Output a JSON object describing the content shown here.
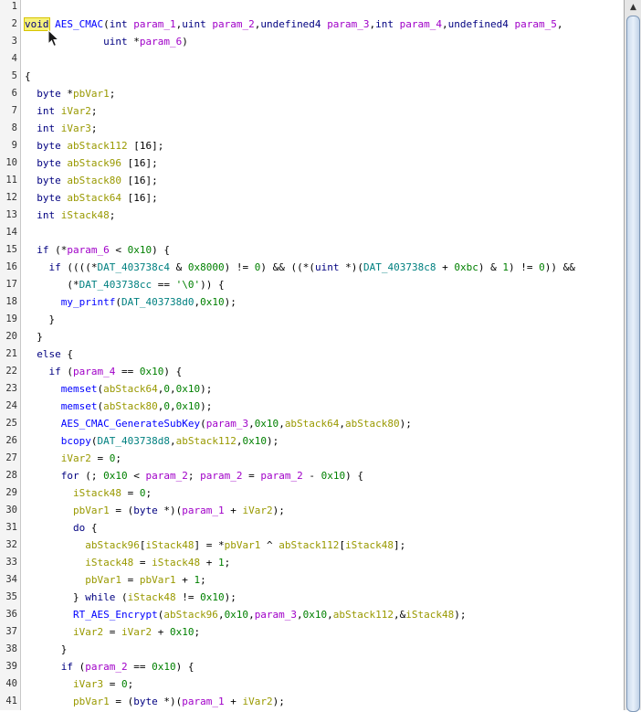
{
  "icons": {
    "cursor": "mouse-pointer-icon",
    "scroll_up": "chevron-up-icon"
  },
  "colors": {
    "keyword": "#000080",
    "function": "#0000ff",
    "variable": "#999900",
    "parameter": "#a000c8",
    "number": "#008000",
    "data": "#008080"
  },
  "lines": [
    {
      "n": "1",
      "tokens": []
    },
    {
      "n": "2",
      "tokens": [
        [
          "kw",
          "void"
        ],
        [
          "p",
          " "
        ],
        [
          "fn",
          "AES_CMAC"
        ],
        [
          "p",
          "("
        ],
        [
          "kw",
          "int"
        ],
        [
          "p",
          " "
        ],
        [
          "prm",
          "param_1"
        ],
        [
          "p",
          ","
        ],
        [
          "kw",
          "uint"
        ],
        [
          "p",
          " "
        ],
        [
          "prm",
          "param_2"
        ],
        [
          "p",
          ","
        ],
        [
          "kw",
          "undefined4"
        ],
        [
          "p",
          " "
        ],
        [
          "prm",
          "param_3"
        ],
        [
          "p",
          ","
        ],
        [
          "kw",
          "int"
        ],
        [
          "p",
          " "
        ],
        [
          "prm",
          "param_4"
        ],
        [
          "p",
          ","
        ],
        [
          "kw",
          "undefined4"
        ],
        [
          "p",
          " "
        ],
        [
          "prm",
          "param_5"
        ],
        [
          "p",
          ","
        ]
      ]
    },
    {
      "n": "3",
      "tokens": [
        [
          "p",
          "             "
        ],
        [
          "kw",
          "uint"
        ],
        [
          "p",
          " *"
        ],
        [
          "prm",
          "param_6"
        ],
        [
          "p",
          ")"
        ]
      ]
    },
    {
      "n": "4",
      "tokens": []
    },
    {
      "n": "5",
      "tokens": [
        [
          "p",
          "{"
        ]
      ]
    },
    {
      "n": "6",
      "tokens": [
        [
          "p",
          "  "
        ],
        [
          "kw",
          "byte"
        ],
        [
          "p",
          " *"
        ],
        [
          "var",
          "pbVar1"
        ],
        [
          "p",
          ";"
        ]
      ]
    },
    {
      "n": "7",
      "tokens": [
        [
          "p",
          "  "
        ],
        [
          "kw",
          "int"
        ],
        [
          "p",
          " "
        ],
        [
          "var",
          "iVar2"
        ],
        [
          "p",
          ";"
        ]
      ]
    },
    {
      "n": "8",
      "tokens": [
        [
          "p",
          "  "
        ],
        [
          "kw",
          "int"
        ],
        [
          "p",
          " "
        ],
        [
          "var",
          "iVar3"
        ],
        [
          "p",
          ";"
        ]
      ]
    },
    {
      "n": "9",
      "tokens": [
        [
          "p",
          "  "
        ],
        [
          "kw",
          "byte"
        ],
        [
          "p",
          " "
        ],
        [
          "var",
          "abStack112"
        ],
        [
          "p",
          " [16];"
        ]
      ]
    },
    {
      "n": "10",
      "tokens": [
        [
          "p",
          "  "
        ],
        [
          "kw",
          "byte"
        ],
        [
          "p",
          " "
        ],
        [
          "var",
          "abStack96"
        ],
        [
          "p",
          " [16];"
        ]
      ]
    },
    {
      "n": "11",
      "tokens": [
        [
          "p",
          "  "
        ],
        [
          "kw",
          "byte"
        ],
        [
          "p",
          " "
        ],
        [
          "var",
          "abStack80"
        ],
        [
          "p",
          " [16];"
        ]
      ]
    },
    {
      "n": "12",
      "tokens": [
        [
          "p",
          "  "
        ],
        [
          "kw",
          "byte"
        ],
        [
          "p",
          " "
        ],
        [
          "var",
          "abStack64"
        ],
        [
          "p",
          " [16];"
        ]
      ]
    },
    {
      "n": "13",
      "tokens": [
        [
          "p",
          "  "
        ],
        [
          "kw",
          "int"
        ],
        [
          "p",
          " "
        ],
        [
          "var",
          "iStack48"
        ],
        [
          "p",
          ";"
        ]
      ]
    },
    {
      "n": "14",
      "tokens": []
    },
    {
      "n": "15",
      "tokens": [
        [
          "p",
          "  "
        ],
        [
          "kw",
          "if"
        ],
        [
          "p",
          " (*"
        ],
        [
          "prm",
          "param_6"
        ],
        [
          "p",
          " < "
        ],
        [
          "num",
          "0x10"
        ],
        [
          "p",
          ") {"
        ]
      ]
    },
    {
      "n": "16",
      "tokens": [
        [
          "p",
          "    "
        ],
        [
          "kw",
          "if"
        ],
        [
          "p",
          " ((((*"
        ],
        [
          "dat",
          "DAT_403738c4"
        ],
        [
          "p",
          " & "
        ],
        [
          "num",
          "0x8000"
        ],
        [
          "p",
          ") != "
        ],
        [
          "num",
          "0"
        ],
        [
          "p",
          ") && ((*("
        ],
        [
          "kw",
          "uint"
        ],
        [
          "p",
          " *)("
        ],
        [
          "dat",
          "DAT_403738c8"
        ],
        [
          "p",
          " + "
        ],
        [
          "num",
          "0xbc"
        ],
        [
          "p",
          ") & "
        ],
        [
          "num",
          "1"
        ],
        [
          "p",
          ") != "
        ],
        [
          "num",
          "0"
        ],
        [
          "p",
          ")) &&"
        ]
      ]
    },
    {
      "n": "17",
      "tokens": [
        [
          "p",
          "       (*"
        ],
        [
          "dat",
          "DAT_403738cc"
        ],
        [
          "p",
          " == "
        ],
        [
          "str",
          "'\\0'"
        ],
        [
          "p",
          ")) {"
        ]
      ]
    },
    {
      "n": "18",
      "tokens": [
        [
          "p",
          "      "
        ],
        [
          "fn",
          "my_printf"
        ],
        [
          "p",
          "("
        ],
        [
          "dat",
          "DAT_403738d0"
        ],
        [
          "p",
          ","
        ],
        [
          "num",
          "0x10"
        ],
        [
          "p",
          ");"
        ]
      ]
    },
    {
      "n": "19",
      "tokens": [
        [
          "p",
          "    }"
        ]
      ]
    },
    {
      "n": "20",
      "tokens": [
        [
          "p",
          "  }"
        ]
      ]
    },
    {
      "n": "21",
      "tokens": [
        [
          "p",
          "  "
        ],
        [
          "kw",
          "else"
        ],
        [
          "p",
          " {"
        ]
      ]
    },
    {
      "n": "22",
      "tokens": [
        [
          "p",
          "    "
        ],
        [
          "kw",
          "if"
        ],
        [
          "p",
          " ("
        ],
        [
          "prm",
          "param_4"
        ],
        [
          "p",
          " == "
        ],
        [
          "num",
          "0x10"
        ],
        [
          "p",
          ") {"
        ]
      ]
    },
    {
      "n": "23",
      "tokens": [
        [
          "p",
          "      "
        ],
        [
          "fn",
          "memset"
        ],
        [
          "p",
          "("
        ],
        [
          "var",
          "abStack64"
        ],
        [
          "p",
          ","
        ],
        [
          "num",
          "0"
        ],
        [
          "p",
          ","
        ],
        [
          "num",
          "0x10"
        ],
        [
          "p",
          ");"
        ]
      ]
    },
    {
      "n": "24",
      "tokens": [
        [
          "p",
          "      "
        ],
        [
          "fn",
          "memset"
        ],
        [
          "p",
          "("
        ],
        [
          "var",
          "abStack80"
        ],
        [
          "p",
          ","
        ],
        [
          "num",
          "0"
        ],
        [
          "p",
          ","
        ],
        [
          "num",
          "0x10"
        ],
        [
          "p",
          ");"
        ]
      ]
    },
    {
      "n": "25",
      "tokens": [
        [
          "p",
          "      "
        ],
        [
          "fn",
          "AES_CMAC_GenerateSubKey"
        ],
        [
          "p",
          "("
        ],
        [
          "prm",
          "param_3"
        ],
        [
          "p",
          ","
        ],
        [
          "num",
          "0x10"
        ],
        [
          "p",
          ","
        ],
        [
          "var",
          "abStack64"
        ],
        [
          "p",
          ","
        ],
        [
          "var",
          "abStack80"
        ],
        [
          "p",
          ");"
        ]
      ]
    },
    {
      "n": "26",
      "tokens": [
        [
          "p",
          "      "
        ],
        [
          "fn",
          "bcopy"
        ],
        [
          "p",
          "("
        ],
        [
          "dat",
          "DAT_403738d8"
        ],
        [
          "p",
          ","
        ],
        [
          "var",
          "abStack112"
        ],
        [
          "p",
          ","
        ],
        [
          "num",
          "0x10"
        ],
        [
          "p",
          ");"
        ]
      ]
    },
    {
      "n": "27",
      "tokens": [
        [
          "p",
          "      "
        ],
        [
          "var",
          "iVar2"
        ],
        [
          "p",
          " = "
        ],
        [
          "num",
          "0"
        ],
        [
          "p",
          ";"
        ]
      ]
    },
    {
      "n": "28",
      "tokens": [
        [
          "p",
          "      "
        ],
        [
          "kw",
          "for"
        ],
        [
          "p",
          " (; "
        ],
        [
          "num",
          "0x10"
        ],
        [
          "p",
          " < "
        ],
        [
          "prm",
          "param_2"
        ],
        [
          "p",
          "; "
        ],
        [
          "prm",
          "param_2"
        ],
        [
          "p",
          " = "
        ],
        [
          "prm",
          "param_2"
        ],
        [
          "p",
          " - "
        ],
        [
          "num",
          "0x10"
        ],
        [
          "p",
          ") {"
        ]
      ]
    },
    {
      "n": "29",
      "tokens": [
        [
          "p",
          "        "
        ],
        [
          "var",
          "iStack48"
        ],
        [
          "p",
          " = "
        ],
        [
          "num",
          "0"
        ],
        [
          "p",
          ";"
        ]
      ]
    },
    {
      "n": "30",
      "tokens": [
        [
          "p",
          "        "
        ],
        [
          "var",
          "pbVar1"
        ],
        [
          "p",
          " = ("
        ],
        [
          "kw",
          "byte"
        ],
        [
          "p",
          " *)("
        ],
        [
          "prm",
          "param_1"
        ],
        [
          "p",
          " + "
        ],
        [
          "var",
          "iVar2"
        ],
        [
          "p",
          ");"
        ]
      ]
    },
    {
      "n": "31",
      "tokens": [
        [
          "p",
          "        "
        ],
        [
          "kw",
          "do"
        ],
        [
          "p",
          " {"
        ]
      ]
    },
    {
      "n": "32",
      "tokens": [
        [
          "p",
          "          "
        ],
        [
          "var",
          "abStack96"
        ],
        [
          "p",
          "["
        ],
        [
          "var",
          "iStack48"
        ],
        [
          "p",
          "] = *"
        ],
        [
          "var",
          "pbVar1"
        ],
        [
          "p",
          " ^ "
        ],
        [
          "var",
          "abStack112"
        ],
        [
          "p",
          "["
        ],
        [
          "var",
          "iStack48"
        ],
        [
          "p",
          "];"
        ]
      ]
    },
    {
      "n": "33",
      "tokens": [
        [
          "p",
          "          "
        ],
        [
          "var",
          "iStack48"
        ],
        [
          "p",
          " = "
        ],
        [
          "var",
          "iStack48"
        ],
        [
          "p",
          " + "
        ],
        [
          "num",
          "1"
        ],
        [
          "p",
          ";"
        ]
      ]
    },
    {
      "n": "34",
      "tokens": [
        [
          "p",
          "          "
        ],
        [
          "var",
          "pbVar1"
        ],
        [
          "p",
          " = "
        ],
        [
          "var",
          "pbVar1"
        ],
        [
          "p",
          " + "
        ],
        [
          "num",
          "1"
        ],
        [
          "p",
          ";"
        ]
      ]
    },
    {
      "n": "35",
      "tokens": [
        [
          "p",
          "        } "
        ],
        [
          "kw",
          "while"
        ],
        [
          "p",
          " ("
        ],
        [
          "var",
          "iStack48"
        ],
        [
          "p",
          " != "
        ],
        [
          "num",
          "0x10"
        ],
        [
          "p",
          ");"
        ]
      ]
    },
    {
      "n": "36",
      "tokens": [
        [
          "p",
          "        "
        ],
        [
          "fn",
          "RT_AES_Encrypt"
        ],
        [
          "p",
          "("
        ],
        [
          "var",
          "abStack96"
        ],
        [
          "p",
          ","
        ],
        [
          "num",
          "0x10"
        ],
        [
          "p",
          ","
        ],
        [
          "prm",
          "param_3"
        ],
        [
          "p",
          ","
        ],
        [
          "num",
          "0x10"
        ],
        [
          "p",
          ","
        ],
        [
          "var",
          "abStack112"
        ],
        [
          "p",
          ",&"
        ],
        [
          "var",
          "iStack48"
        ],
        [
          "p",
          ");"
        ]
      ]
    },
    {
      "n": "37",
      "tokens": [
        [
          "p",
          "        "
        ],
        [
          "var",
          "iVar2"
        ],
        [
          "p",
          " = "
        ],
        [
          "var",
          "iVar2"
        ],
        [
          "p",
          " + "
        ],
        [
          "num",
          "0x10"
        ],
        [
          "p",
          ";"
        ]
      ]
    },
    {
      "n": "38",
      "tokens": [
        [
          "p",
          "      }"
        ]
      ]
    },
    {
      "n": "39",
      "tokens": [
        [
          "p",
          "      "
        ],
        [
          "kw",
          "if"
        ],
        [
          "p",
          " ("
        ],
        [
          "prm",
          "param_2"
        ],
        [
          "p",
          " == "
        ],
        [
          "num",
          "0x10"
        ],
        [
          "p",
          ") {"
        ]
      ]
    },
    {
      "n": "40",
      "tokens": [
        [
          "p",
          "        "
        ],
        [
          "var",
          "iVar3"
        ],
        [
          "p",
          " = "
        ],
        [
          "num",
          "0"
        ],
        [
          "p",
          ";"
        ]
      ]
    },
    {
      "n": "41",
      "tokens": [
        [
          "p",
          "        "
        ],
        [
          "var",
          "pbVar1"
        ],
        [
          "p",
          " = ("
        ],
        [
          "kw",
          "byte"
        ],
        [
          "p",
          " *)("
        ],
        [
          "prm",
          "param_1"
        ],
        [
          "p",
          " + "
        ],
        [
          "var",
          "iVar2"
        ],
        [
          "p",
          ");"
        ]
      ]
    }
  ]
}
